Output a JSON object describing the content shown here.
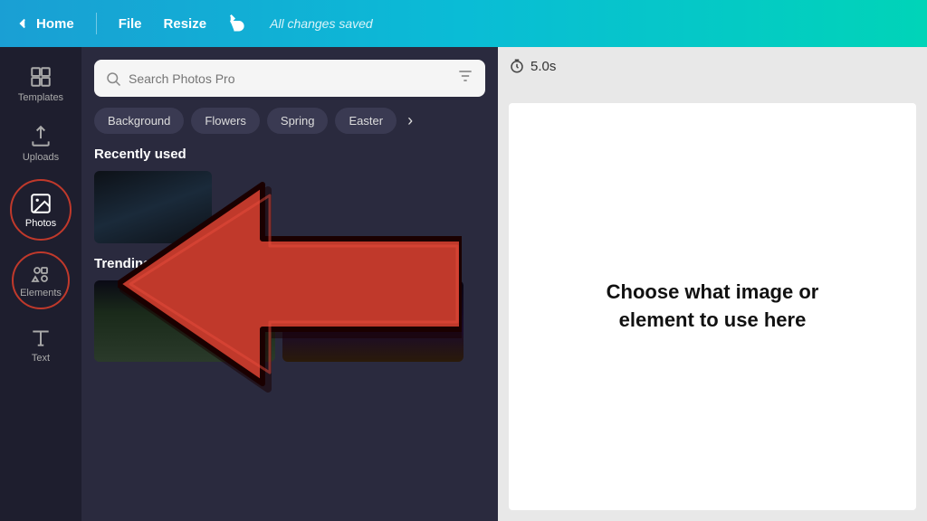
{
  "topbar": {
    "home_label": "Home",
    "file_label": "File",
    "resize_label": "Resize",
    "saved_label": "All changes saved"
  },
  "sidebar": {
    "items": [
      {
        "id": "templates",
        "label": "Templates",
        "active": false
      },
      {
        "id": "uploads",
        "label": "Uploads",
        "active": false
      },
      {
        "id": "photos",
        "label": "Photos",
        "active": true
      },
      {
        "id": "elements",
        "label": "Elements",
        "active": false
      },
      {
        "id": "text",
        "label": "Text",
        "active": false
      }
    ]
  },
  "panel": {
    "search_placeholder": "Search Photos Pro",
    "categories": [
      "Background",
      "Flowers",
      "Spring",
      "Easter"
    ],
    "recently_label": "Recently used",
    "trending_label": "Trending"
  },
  "canvas": {
    "timer": "5.0s",
    "instruction": "Choose what image or element to use here"
  }
}
